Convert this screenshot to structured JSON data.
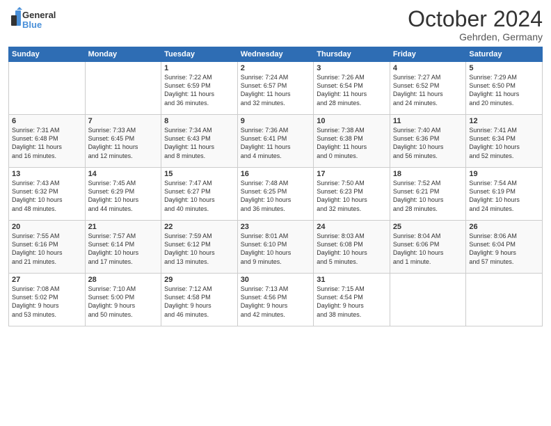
{
  "header": {
    "logo_line1": "General",
    "logo_line2": "Blue",
    "month_title": "October 2024",
    "location": "Gehrden, Germany"
  },
  "days_of_week": [
    "Sunday",
    "Monday",
    "Tuesday",
    "Wednesday",
    "Thursday",
    "Friday",
    "Saturday"
  ],
  "weeks": [
    [
      {
        "day": "",
        "content": ""
      },
      {
        "day": "",
        "content": ""
      },
      {
        "day": "1",
        "content": "Sunrise: 7:22 AM\nSunset: 6:59 PM\nDaylight: 11 hours\nand 36 minutes."
      },
      {
        "day": "2",
        "content": "Sunrise: 7:24 AM\nSunset: 6:57 PM\nDaylight: 11 hours\nand 32 minutes."
      },
      {
        "day": "3",
        "content": "Sunrise: 7:26 AM\nSunset: 6:54 PM\nDaylight: 11 hours\nand 28 minutes."
      },
      {
        "day": "4",
        "content": "Sunrise: 7:27 AM\nSunset: 6:52 PM\nDaylight: 11 hours\nand 24 minutes."
      },
      {
        "day": "5",
        "content": "Sunrise: 7:29 AM\nSunset: 6:50 PM\nDaylight: 11 hours\nand 20 minutes."
      }
    ],
    [
      {
        "day": "6",
        "content": "Sunrise: 7:31 AM\nSunset: 6:48 PM\nDaylight: 11 hours\nand 16 minutes."
      },
      {
        "day": "7",
        "content": "Sunrise: 7:33 AM\nSunset: 6:45 PM\nDaylight: 11 hours\nand 12 minutes."
      },
      {
        "day": "8",
        "content": "Sunrise: 7:34 AM\nSunset: 6:43 PM\nDaylight: 11 hours\nand 8 minutes."
      },
      {
        "day": "9",
        "content": "Sunrise: 7:36 AM\nSunset: 6:41 PM\nDaylight: 11 hours\nand 4 minutes."
      },
      {
        "day": "10",
        "content": "Sunrise: 7:38 AM\nSunset: 6:38 PM\nDaylight: 11 hours\nand 0 minutes."
      },
      {
        "day": "11",
        "content": "Sunrise: 7:40 AM\nSunset: 6:36 PM\nDaylight: 10 hours\nand 56 minutes."
      },
      {
        "day": "12",
        "content": "Sunrise: 7:41 AM\nSunset: 6:34 PM\nDaylight: 10 hours\nand 52 minutes."
      }
    ],
    [
      {
        "day": "13",
        "content": "Sunrise: 7:43 AM\nSunset: 6:32 PM\nDaylight: 10 hours\nand 48 minutes."
      },
      {
        "day": "14",
        "content": "Sunrise: 7:45 AM\nSunset: 6:29 PM\nDaylight: 10 hours\nand 44 minutes."
      },
      {
        "day": "15",
        "content": "Sunrise: 7:47 AM\nSunset: 6:27 PM\nDaylight: 10 hours\nand 40 minutes."
      },
      {
        "day": "16",
        "content": "Sunrise: 7:48 AM\nSunset: 6:25 PM\nDaylight: 10 hours\nand 36 minutes."
      },
      {
        "day": "17",
        "content": "Sunrise: 7:50 AM\nSunset: 6:23 PM\nDaylight: 10 hours\nand 32 minutes."
      },
      {
        "day": "18",
        "content": "Sunrise: 7:52 AM\nSunset: 6:21 PM\nDaylight: 10 hours\nand 28 minutes."
      },
      {
        "day": "19",
        "content": "Sunrise: 7:54 AM\nSunset: 6:19 PM\nDaylight: 10 hours\nand 24 minutes."
      }
    ],
    [
      {
        "day": "20",
        "content": "Sunrise: 7:55 AM\nSunset: 6:16 PM\nDaylight: 10 hours\nand 21 minutes."
      },
      {
        "day": "21",
        "content": "Sunrise: 7:57 AM\nSunset: 6:14 PM\nDaylight: 10 hours\nand 17 minutes."
      },
      {
        "day": "22",
        "content": "Sunrise: 7:59 AM\nSunset: 6:12 PM\nDaylight: 10 hours\nand 13 minutes."
      },
      {
        "day": "23",
        "content": "Sunrise: 8:01 AM\nSunset: 6:10 PM\nDaylight: 10 hours\nand 9 minutes."
      },
      {
        "day": "24",
        "content": "Sunrise: 8:03 AM\nSunset: 6:08 PM\nDaylight: 10 hours\nand 5 minutes."
      },
      {
        "day": "25",
        "content": "Sunrise: 8:04 AM\nSunset: 6:06 PM\nDaylight: 10 hours\nand 1 minute."
      },
      {
        "day": "26",
        "content": "Sunrise: 8:06 AM\nSunset: 6:04 PM\nDaylight: 9 hours\nand 57 minutes."
      }
    ],
    [
      {
        "day": "27",
        "content": "Sunrise: 7:08 AM\nSunset: 5:02 PM\nDaylight: 9 hours\nand 53 minutes."
      },
      {
        "day": "28",
        "content": "Sunrise: 7:10 AM\nSunset: 5:00 PM\nDaylight: 9 hours\nand 50 minutes."
      },
      {
        "day": "29",
        "content": "Sunrise: 7:12 AM\nSunset: 4:58 PM\nDaylight: 9 hours\nand 46 minutes."
      },
      {
        "day": "30",
        "content": "Sunrise: 7:13 AM\nSunset: 4:56 PM\nDaylight: 9 hours\nand 42 minutes."
      },
      {
        "day": "31",
        "content": "Sunrise: 7:15 AM\nSunset: 4:54 PM\nDaylight: 9 hours\nand 38 minutes."
      },
      {
        "day": "",
        "content": ""
      },
      {
        "day": "",
        "content": ""
      }
    ]
  ]
}
